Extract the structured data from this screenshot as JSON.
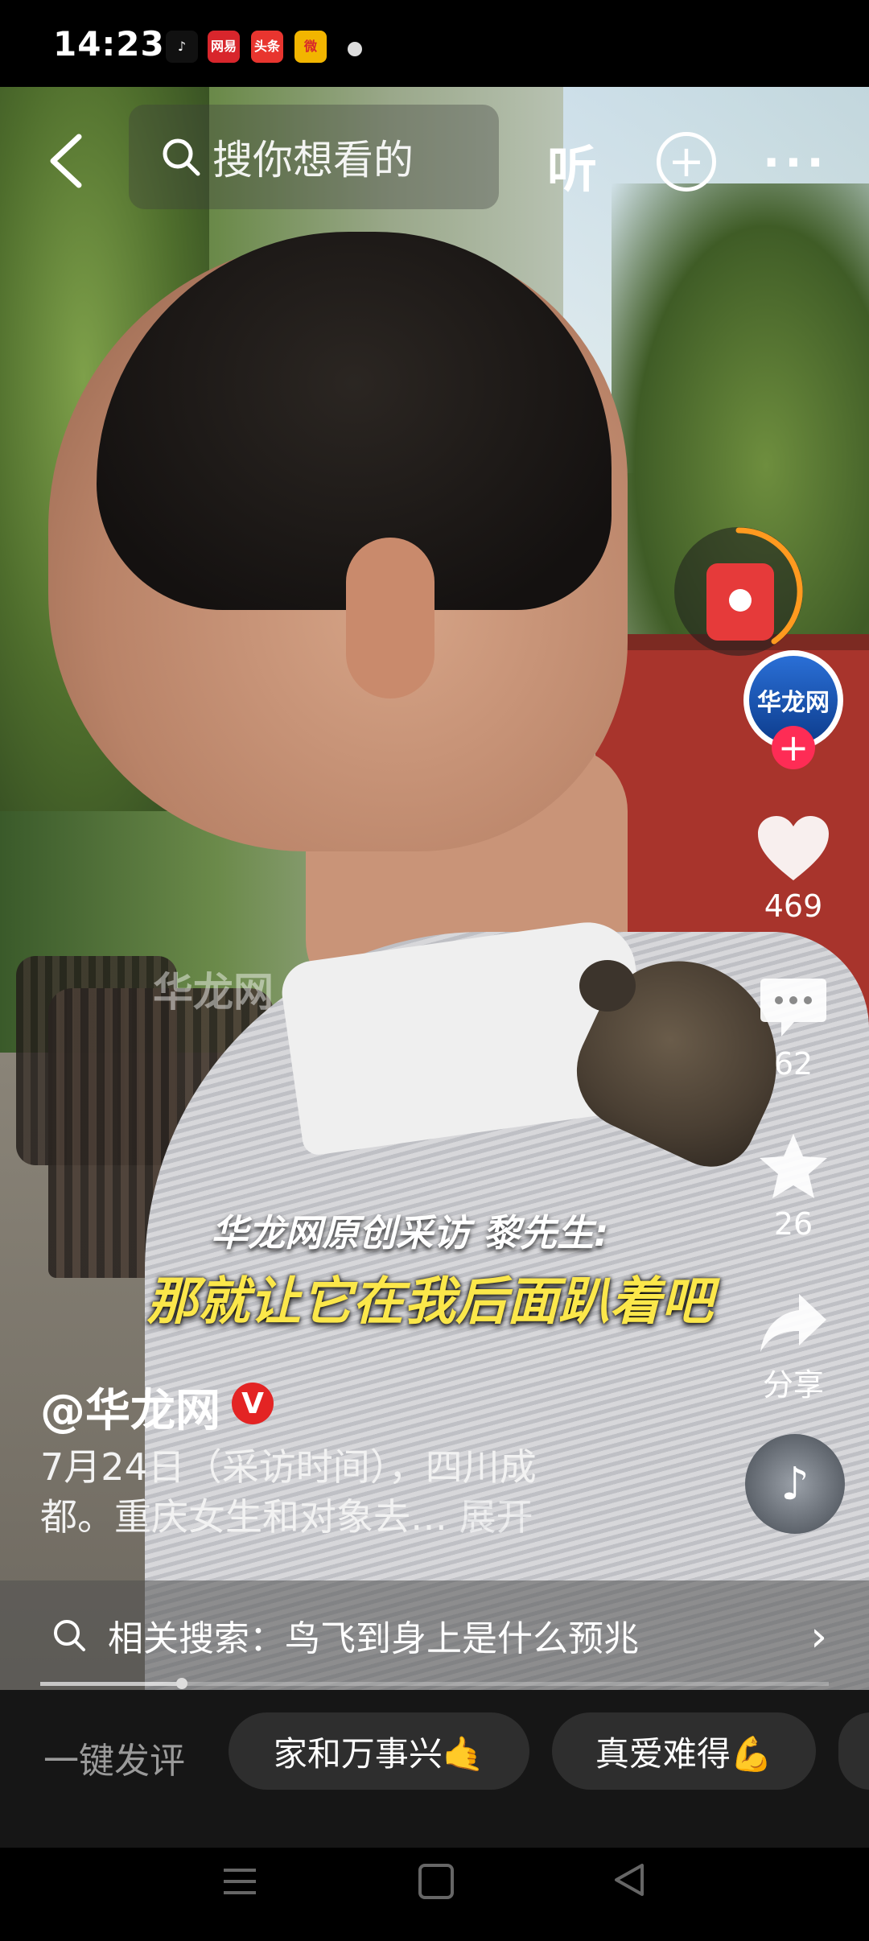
{
  "status_bar": {
    "time": "14:23",
    "apps": [
      {
        "icon": "tiktok-icon",
        "label": "♪",
        "bg": "#111111",
        "fg": "#ffffff"
      },
      {
        "icon": "netease-news-icon",
        "label": "网易",
        "bg": "#d8262c",
        "fg": "#ffffff"
      },
      {
        "icon": "toutiao-icon",
        "label": "头条",
        "bg": "#e8352f",
        "fg": "#ffffff"
      },
      {
        "icon": "weibo-icon",
        "label": "微",
        "bg": "#f2b500",
        "fg": "#d8262c"
      }
    ]
  },
  "top_bar": {
    "search_placeholder": "搜你想看的",
    "listen_label": "听",
    "add_icon": "plus-circle-icon",
    "more_icon": "more-dots-icon"
  },
  "video": {
    "watermark": "华龙网",
    "caption_line1": "华龙网原创采访 黎先生:",
    "caption_line2": "那就让它在我后面趴着吧"
  },
  "right_panel": {
    "avatar_text": "华龙网",
    "like_count": "469",
    "comment_count": "62",
    "favorite_count": "26",
    "share_label": "分享"
  },
  "post": {
    "author": "@华龙网",
    "verified_badge": "V",
    "description_line1": "7月24日（采访时间），四川成",
    "description_line2": "都。重庆女生和对象去…",
    "expand_label": "展开"
  },
  "related_search": {
    "text": "相关搜索：鸟飞到身上是什么预兆"
  },
  "progress": {
    "played_fraction": 0.18
  },
  "comment_bar": {
    "quick_label": "一键发评",
    "chips": [
      "家和万事兴🤙",
      "真爱难得💪"
    ]
  },
  "colors": {
    "accent_red": "#fe2c55",
    "caption_yellow": "#fbe74a",
    "bottom_bar_bg": "#161616"
  }
}
